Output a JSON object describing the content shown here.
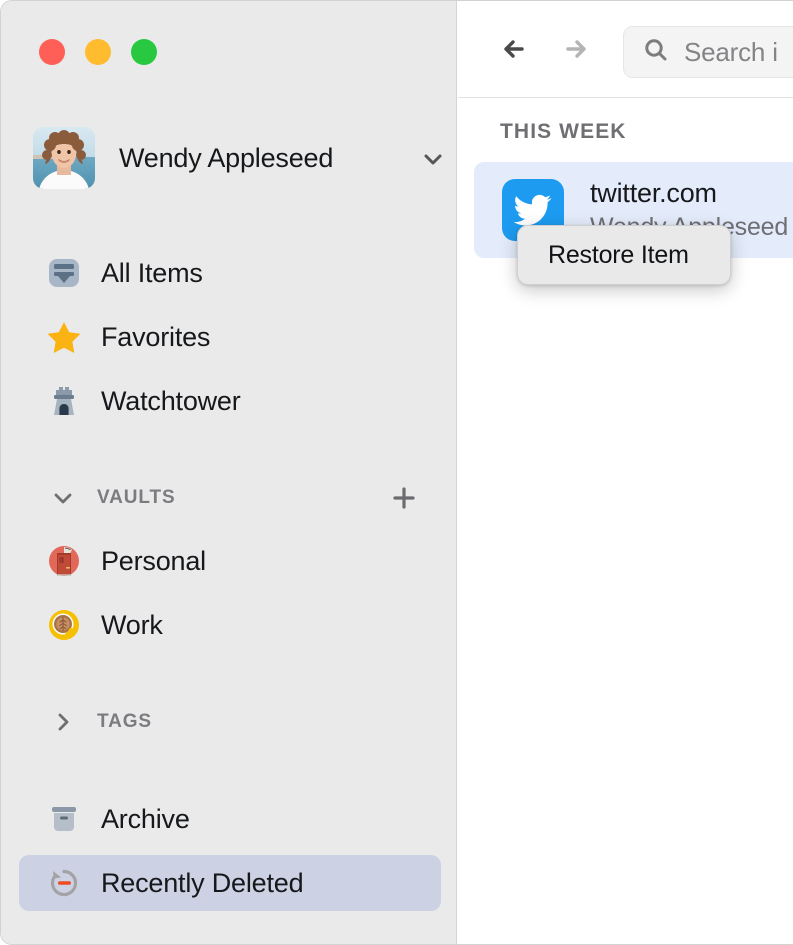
{
  "window": {
    "traffic_lights": [
      {
        "name": "close",
        "color": "#ff5f57"
      },
      {
        "name": "minimize",
        "color": "#febc2e"
      },
      {
        "name": "maximize",
        "color": "#28c840"
      }
    ]
  },
  "sidebar": {
    "account": {
      "name": "Wendy Appleseed",
      "avatar_icon": "user-photo-avatar",
      "chevron_icon": "chevron-down-icon"
    },
    "primary_items": [
      {
        "label": "All Items",
        "icon": "all-items-icon",
        "selected": false
      },
      {
        "label": "Favorites",
        "icon": "star-icon",
        "selected": false
      },
      {
        "label": "Watchtower",
        "icon": "watchtower-icon",
        "selected": false
      }
    ],
    "vaults_section": {
      "title": "VAULTS",
      "twisty_icon": "chevron-down-icon",
      "expanded": true,
      "add_icon": "plus-icon"
    },
    "vaults": [
      {
        "label": "Personal",
        "icon": "vault-door-icon",
        "selected": false
      },
      {
        "label": "Work",
        "icon": "vault-coffee-icon",
        "selected": false
      }
    ],
    "tags_section": {
      "title": "TAGS",
      "twisty_icon": "chevron-right-icon",
      "expanded": false
    },
    "secondary_items": [
      {
        "label": "Archive",
        "icon": "archive-icon",
        "selected": false
      },
      {
        "label": "Recently Deleted",
        "icon": "recently-deleted-icon",
        "selected": true
      }
    ]
  },
  "main": {
    "toolbar": {
      "back_icon": "arrow-left-icon",
      "forward_icon": "arrow-right-icon",
      "search": {
        "icon": "search-icon",
        "placeholder": "Search i"
      }
    },
    "list": {
      "section_header": "THIS WEEK",
      "rows": [
        {
          "title": "twitter.com",
          "subtitle": "Wendy Appleseed",
          "icon": "twitter-icon",
          "icon_color": "#1d9bf0",
          "selected": true
        }
      ]
    },
    "context_menu": {
      "items": [
        {
          "label": "Restore Item"
        }
      ]
    }
  },
  "colors": {
    "sidebar_bg": "#eaeaea",
    "selection_sidebar": "#ccd2e3",
    "selection_list": "#e4ecfb",
    "menu_bg": "#e9e9e9",
    "text_primary": "#16181b",
    "text_secondary": "#6e6e73"
  }
}
